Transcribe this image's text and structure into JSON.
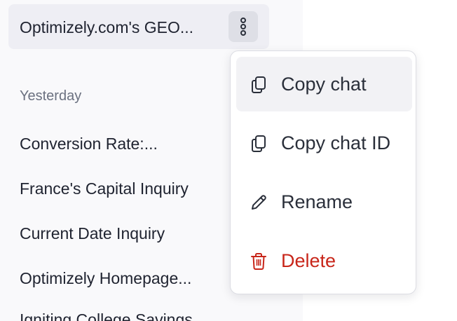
{
  "sidebar": {
    "active_chat": {
      "title": "Optimizely.com's GEO...",
      "more_icon": "vertical-ellipsis-icon"
    },
    "section_label": "Yesterday",
    "chats": [
      {
        "title": "Conversion Rate:..."
      },
      {
        "title": "France's Capital Inquiry"
      },
      {
        "title": "Current Date Inquiry"
      },
      {
        "title": "Optimizely Homepage..."
      },
      {
        "title": "Igniting College Savings..."
      }
    ]
  },
  "context_menu": {
    "items": [
      {
        "label": "Copy chat",
        "icon": "copy-icon"
      },
      {
        "label": "Copy chat ID",
        "icon": "copy-icon"
      },
      {
        "label": "Rename",
        "icon": "pencil-icon"
      },
      {
        "label": "Delete",
        "icon": "trash-icon"
      }
    ]
  },
  "colors": {
    "danger": "#c8261a",
    "active_chat_bg": "#eeeef4",
    "menu_hover_bg": "#f2f2f5"
  }
}
